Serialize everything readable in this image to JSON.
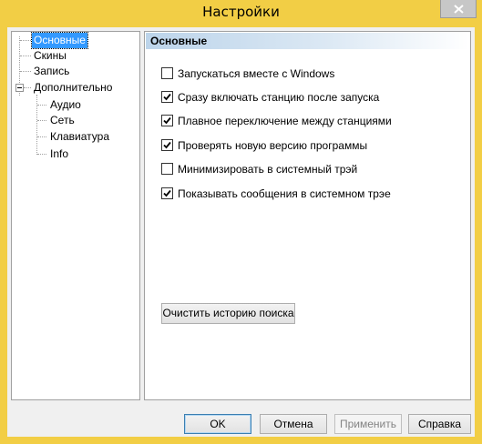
{
  "window": {
    "title": "Настройки"
  },
  "tree": {
    "items": [
      {
        "label": "Основные",
        "selected": true
      },
      {
        "label": "Скины"
      },
      {
        "label": "Запись"
      },
      {
        "label": "Дополнительно",
        "expanded": true
      },
      {
        "label": "Аудио"
      },
      {
        "label": "Сеть"
      },
      {
        "label": "Клавиатура"
      },
      {
        "label": "Info"
      }
    ]
  },
  "panel": {
    "title": "Основные",
    "options": [
      {
        "label": "Запускаться вместе с Windows",
        "checked": false
      },
      {
        "label": "Сразу включать станцию после запуска",
        "checked": true
      },
      {
        "label": "Плавное переключение между станциями",
        "checked": true
      },
      {
        "label": "Проверять новую версию программы",
        "checked": true
      },
      {
        "label": "Минимизировать в системный трэй",
        "checked": false
      },
      {
        "label": "Показывать сообщения в системном трэе",
        "checked": true
      }
    ],
    "clear_history_label": "Очистить историю поиска"
  },
  "footer": {
    "ok_label": "OK",
    "cancel_label": "Отмена",
    "apply_label": "Применить",
    "help_label": "Справка"
  },
  "colors": {
    "window_frame": "#f2ce45",
    "selection": "#3399ff"
  }
}
